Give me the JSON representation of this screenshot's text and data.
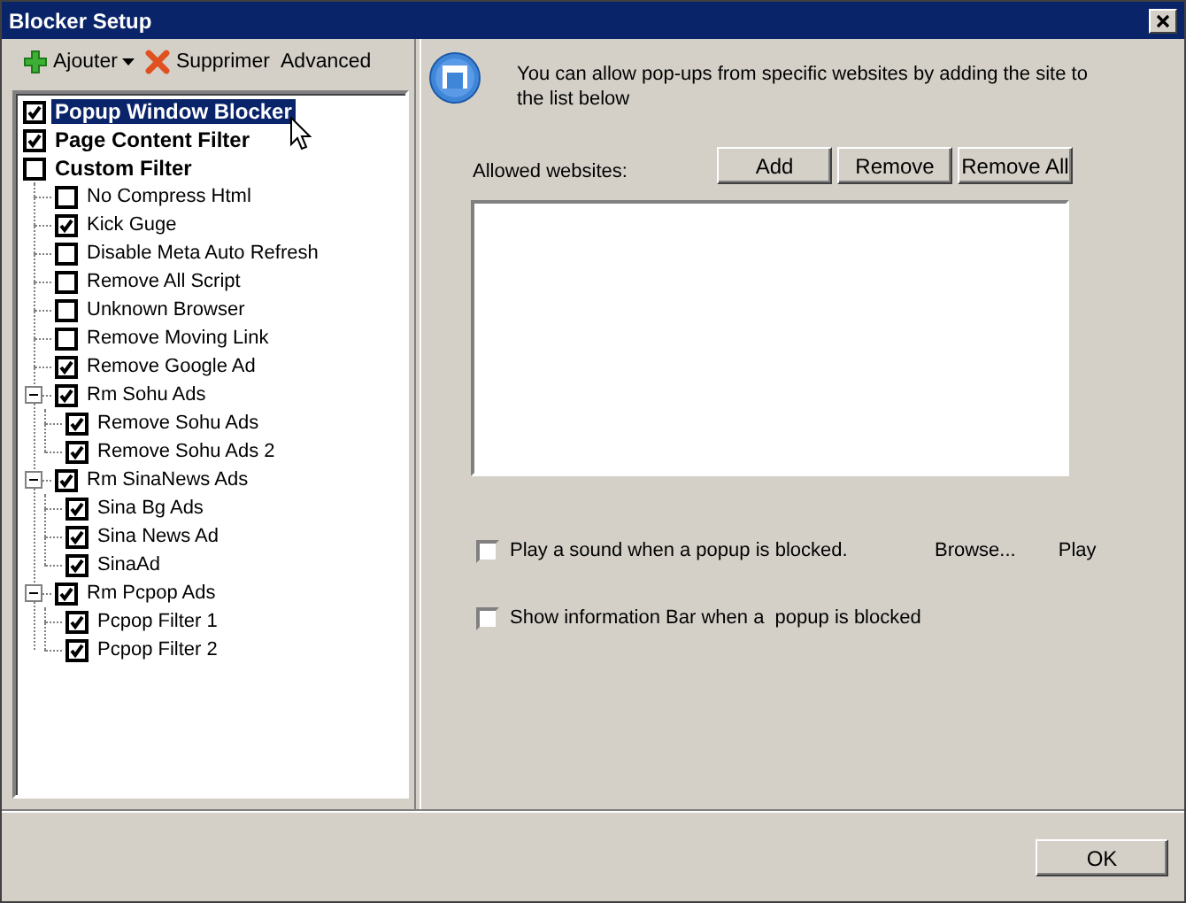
{
  "window": {
    "title": "Blocker Setup"
  },
  "toolbar": [
    {
      "kind": "add",
      "label": "Ajouter",
      "dropdown": true
    },
    {
      "kind": "delete",
      "label": "Supprimer",
      "dropdown": false
    },
    {
      "kind": "plain",
      "label": "Advanced",
      "dropdown": false
    }
  ],
  "tree": [
    {
      "label": "Popup Window Blocker",
      "checked": true,
      "selected": true
    },
    {
      "label": "Page Content Filter",
      "checked": true,
      "selected": false
    },
    {
      "label": "Custom Filter",
      "checked": false,
      "selected": false,
      "children": [
        {
          "label": "No Compress Html",
          "checked": false,
          "selected": false
        },
        {
          "label": "Kick Guge",
          "checked": true,
          "selected": false
        },
        {
          "label": "Disable Meta Auto Refresh",
          "checked": false,
          "selected": false
        },
        {
          "label": "Remove All Script",
          "checked": false,
          "selected": false
        },
        {
          "label": "Unknown Browser",
          "checked": false,
          "selected": false
        },
        {
          "label": "Remove Moving Link",
          "checked": false,
          "selected": false
        },
        {
          "label": "Remove Google Ad",
          "checked": true,
          "selected": false
        },
        {
          "label": "Rm Sohu Ads",
          "checked": true,
          "selected": false,
          "expanded": true,
          "children": [
            {
              "label": "Remove Sohu Ads",
              "checked": true,
              "selected": false
            },
            {
              "label": "Remove Sohu Ads 2",
              "checked": true,
              "selected": false
            }
          ]
        },
        {
          "label": "Rm SinaNews Ads",
          "checked": true,
          "selected": false,
          "expanded": true,
          "children": [
            {
              "label": "Sina Bg Ads",
              "checked": true,
              "selected": false
            },
            {
              "label": "Sina News Ad",
              "checked": true,
              "selected": false
            },
            {
              "label": "SinaAd",
              "checked": true,
              "selected": false
            }
          ]
        },
        {
          "label": "Rm Pcpop Ads",
          "checked": true,
          "selected": false,
          "expanded": true,
          "children": [
            {
              "label": "Pcpop Filter 1",
              "checked": true,
              "selected": false
            },
            {
              "label": "Pcpop Filter 2",
              "checked": true,
              "selected": false
            }
          ]
        }
      ]
    }
  ],
  "info": {
    "text": "You can allow pop-ups from specific websites by adding the site to the list below"
  },
  "allowed_websites": {
    "label": "Allowed websites:",
    "buttons": [
      "Add",
      "Remove",
      "Remove All"
    ]
  },
  "options": [
    {
      "label": "Play a sound when a popup is blocked.",
      "checked": false,
      "actions": [
        "Browse...",
        "Play"
      ]
    },
    {
      "label": "Show information Bar when a  popup is blocked",
      "checked": false
    }
  ],
  "footer": {
    "buttons": [
      "OK"
    ]
  }
}
